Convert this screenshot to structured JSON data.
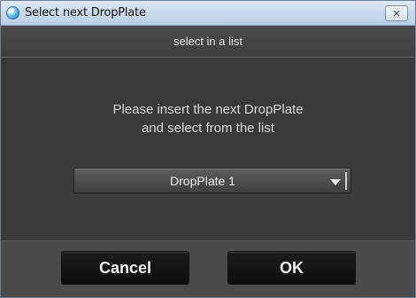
{
  "window": {
    "title": "Select next DropPlate",
    "close_icon": "close-icon",
    "app_icon": "app-icon"
  },
  "header": {
    "subtitle": "select in a list"
  },
  "main": {
    "instruction_line1": "Please insert the next DropPlate",
    "instruction_line2": "and select from the list",
    "dropdown": {
      "selected": "DropPlate 1",
      "icon": "chevron-down-icon"
    }
  },
  "footer": {
    "cancel_label": "Cancel",
    "ok_label": "OK"
  },
  "colors": {
    "background": "#3a3a3a",
    "button_bg": "#141414",
    "text": "#d8d8d8",
    "titlebar": "#c8d8ea"
  }
}
